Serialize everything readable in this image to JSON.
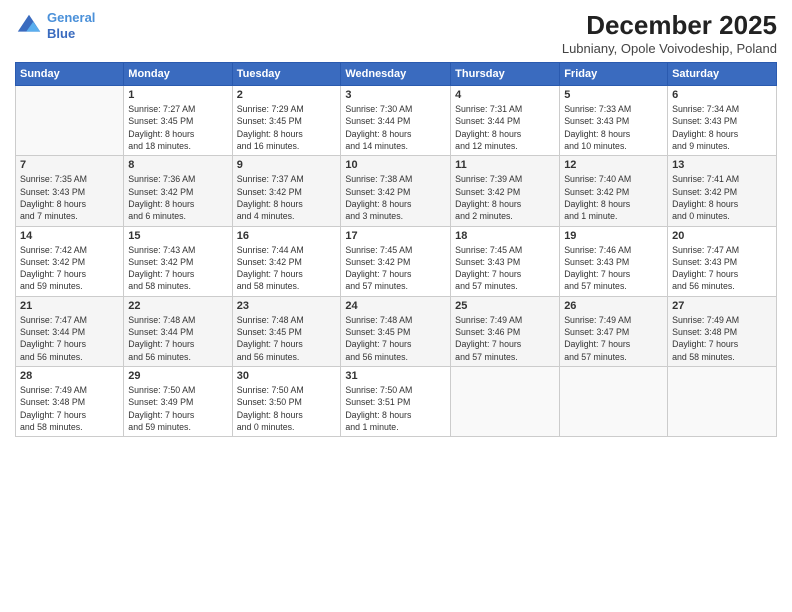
{
  "header": {
    "logo_line1": "General",
    "logo_line2": "Blue",
    "title": "December 2025",
    "subtitle": "Lubniany, Opole Voivodeship, Poland"
  },
  "days_of_week": [
    "Sunday",
    "Monday",
    "Tuesday",
    "Wednesday",
    "Thursday",
    "Friday",
    "Saturday"
  ],
  "weeks": [
    [
      {
        "day": "",
        "info": ""
      },
      {
        "day": "1",
        "info": "Sunrise: 7:27 AM\nSunset: 3:45 PM\nDaylight: 8 hours\nand 18 minutes."
      },
      {
        "day": "2",
        "info": "Sunrise: 7:29 AM\nSunset: 3:45 PM\nDaylight: 8 hours\nand 16 minutes."
      },
      {
        "day": "3",
        "info": "Sunrise: 7:30 AM\nSunset: 3:44 PM\nDaylight: 8 hours\nand 14 minutes."
      },
      {
        "day": "4",
        "info": "Sunrise: 7:31 AM\nSunset: 3:44 PM\nDaylight: 8 hours\nand 12 minutes."
      },
      {
        "day": "5",
        "info": "Sunrise: 7:33 AM\nSunset: 3:43 PM\nDaylight: 8 hours\nand 10 minutes."
      },
      {
        "day": "6",
        "info": "Sunrise: 7:34 AM\nSunset: 3:43 PM\nDaylight: 8 hours\nand 9 minutes."
      }
    ],
    [
      {
        "day": "7",
        "info": "Sunrise: 7:35 AM\nSunset: 3:43 PM\nDaylight: 8 hours\nand 7 minutes."
      },
      {
        "day": "8",
        "info": "Sunrise: 7:36 AM\nSunset: 3:42 PM\nDaylight: 8 hours\nand 6 minutes."
      },
      {
        "day": "9",
        "info": "Sunrise: 7:37 AM\nSunset: 3:42 PM\nDaylight: 8 hours\nand 4 minutes."
      },
      {
        "day": "10",
        "info": "Sunrise: 7:38 AM\nSunset: 3:42 PM\nDaylight: 8 hours\nand 3 minutes."
      },
      {
        "day": "11",
        "info": "Sunrise: 7:39 AM\nSunset: 3:42 PM\nDaylight: 8 hours\nand 2 minutes."
      },
      {
        "day": "12",
        "info": "Sunrise: 7:40 AM\nSunset: 3:42 PM\nDaylight: 8 hours\nand 1 minute."
      },
      {
        "day": "13",
        "info": "Sunrise: 7:41 AM\nSunset: 3:42 PM\nDaylight: 8 hours\nand 0 minutes."
      }
    ],
    [
      {
        "day": "14",
        "info": "Sunrise: 7:42 AM\nSunset: 3:42 PM\nDaylight: 7 hours\nand 59 minutes."
      },
      {
        "day": "15",
        "info": "Sunrise: 7:43 AM\nSunset: 3:42 PM\nDaylight: 7 hours\nand 58 minutes."
      },
      {
        "day": "16",
        "info": "Sunrise: 7:44 AM\nSunset: 3:42 PM\nDaylight: 7 hours\nand 58 minutes."
      },
      {
        "day": "17",
        "info": "Sunrise: 7:45 AM\nSunset: 3:42 PM\nDaylight: 7 hours\nand 57 minutes."
      },
      {
        "day": "18",
        "info": "Sunrise: 7:45 AM\nSunset: 3:43 PM\nDaylight: 7 hours\nand 57 minutes."
      },
      {
        "day": "19",
        "info": "Sunrise: 7:46 AM\nSunset: 3:43 PM\nDaylight: 7 hours\nand 57 minutes."
      },
      {
        "day": "20",
        "info": "Sunrise: 7:47 AM\nSunset: 3:43 PM\nDaylight: 7 hours\nand 56 minutes."
      }
    ],
    [
      {
        "day": "21",
        "info": "Sunrise: 7:47 AM\nSunset: 3:44 PM\nDaylight: 7 hours\nand 56 minutes."
      },
      {
        "day": "22",
        "info": "Sunrise: 7:48 AM\nSunset: 3:44 PM\nDaylight: 7 hours\nand 56 minutes."
      },
      {
        "day": "23",
        "info": "Sunrise: 7:48 AM\nSunset: 3:45 PM\nDaylight: 7 hours\nand 56 minutes."
      },
      {
        "day": "24",
        "info": "Sunrise: 7:48 AM\nSunset: 3:45 PM\nDaylight: 7 hours\nand 56 minutes."
      },
      {
        "day": "25",
        "info": "Sunrise: 7:49 AM\nSunset: 3:46 PM\nDaylight: 7 hours\nand 57 minutes."
      },
      {
        "day": "26",
        "info": "Sunrise: 7:49 AM\nSunset: 3:47 PM\nDaylight: 7 hours\nand 57 minutes."
      },
      {
        "day": "27",
        "info": "Sunrise: 7:49 AM\nSunset: 3:48 PM\nDaylight: 7 hours\nand 58 minutes."
      }
    ],
    [
      {
        "day": "28",
        "info": "Sunrise: 7:49 AM\nSunset: 3:48 PM\nDaylight: 7 hours\nand 58 minutes."
      },
      {
        "day": "29",
        "info": "Sunrise: 7:50 AM\nSunset: 3:49 PM\nDaylight: 7 hours\nand 59 minutes."
      },
      {
        "day": "30",
        "info": "Sunrise: 7:50 AM\nSunset: 3:50 PM\nDaylight: 8 hours\nand 0 minutes."
      },
      {
        "day": "31",
        "info": "Sunrise: 7:50 AM\nSunset: 3:51 PM\nDaylight: 8 hours\nand 1 minute."
      },
      {
        "day": "",
        "info": ""
      },
      {
        "day": "",
        "info": ""
      },
      {
        "day": "",
        "info": ""
      }
    ]
  ]
}
